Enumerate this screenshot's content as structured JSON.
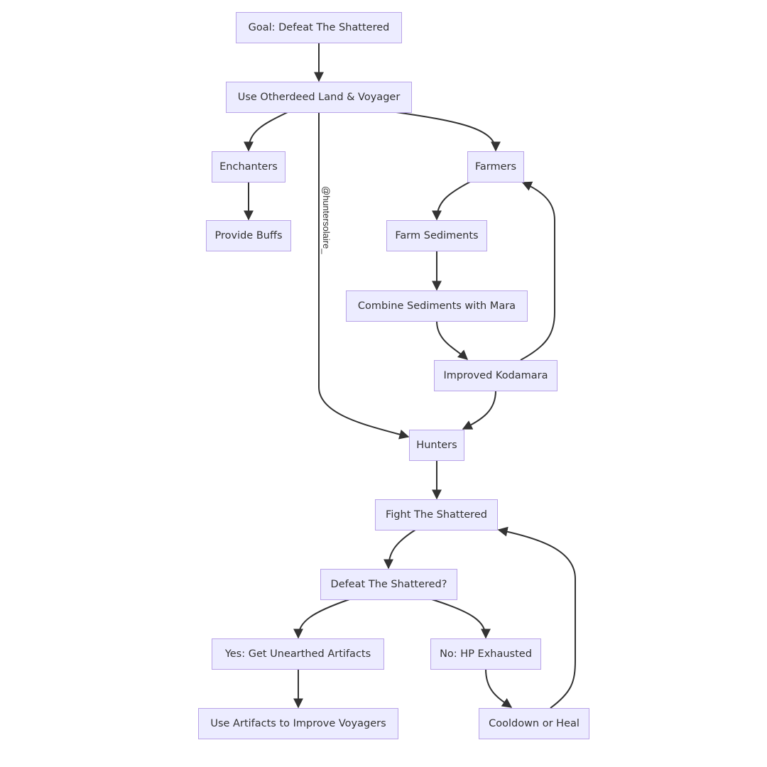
{
  "diagram": {
    "type": "flowchart",
    "direction": "top-down",
    "colors": {
      "node_fill": "#ECECFF",
      "node_border": "#B9A3E8",
      "edge": "#333333",
      "text": "#333333"
    },
    "nodes": [
      {
        "id": "goal",
        "label": "Goal: Defeat The Shattered"
      },
      {
        "id": "use_land",
        "label": "Use Otherdeed Land & Voyager"
      },
      {
        "id": "enchanters",
        "label": "Enchanters"
      },
      {
        "id": "farmers",
        "label": "Farmers"
      },
      {
        "id": "buffs",
        "label": "Provide Buffs"
      },
      {
        "id": "farm_sed",
        "label": "Farm Sediments"
      },
      {
        "id": "combine",
        "label": "Combine Sediments with Mara"
      },
      {
        "id": "kodamara",
        "label": "Improved Kodamara"
      },
      {
        "id": "hunters",
        "label": "Hunters"
      },
      {
        "id": "fight",
        "label": "Fight The Shattered"
      },
      {
        "id": "defeat_q",
        "label": "Defeat The Shattered?"
      },
      {
        "id": "yes",
        "label": "Yes: Get Unearthed Artifacts"
      },
      {
        "id": "no",
        "label": "No: HP Exhausted"
      },
      {
        "id": "use_art",
        "label": "Use Artifacts to Improve Voyagers"
      },
      {
        "id": "cooldown",
        "label": "Cooldown or Heal"
      }
    ],
    "edges": [
      {
        "from": "goal",
        "to": "use_land"
      },
      {
        "from": "use_land",
        "to": "enchanters"
      },
      {
        "from": "use_land",
        "to": "hunters"
      },
      {
        "from": "use_land",
        "to": "farmers"
      },
      {
        "from": "enchanters",
        "to": "buffs"
      },
      {
        "from": "farmers",
        "to": "farm_sed"
      },
      {
        "from": "farm_sed",
        "to": "combine"
      },
      {
        "from": "combine",
        "to": "kodamara"
      },
      {
        "from": "kodamara",
        "to": "farmers"
      },
      {
        "from": "kodamara",
        "to": "hunters"
      },
      {
        "from": "hunters",
        "to": "fight"
      },
      {
        "from": "fight",
        "to": "defeat_q"
      },
      {
        "from": "defeat_q",
        "to": "yes"
      },
      {
        "from": "defeat_q",
        "to": "no"
      },
      {
        "from": "yes",
        "to": "use_art"
      },
      {
        "from": "no",
        "to": "cooldown"
      },
      {
        "from": "cooldown",
        "to": "fight"
      }
    ],
    "watermark": "@huntersolaire_"
  }
}
